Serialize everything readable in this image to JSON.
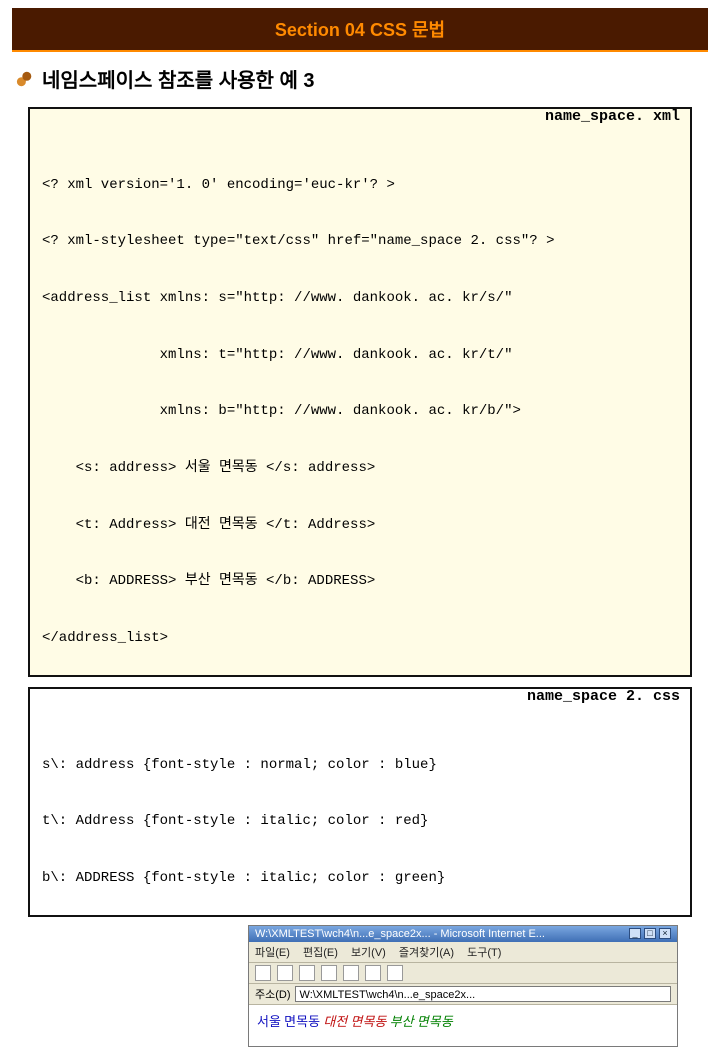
{
  "banner": {
    "title": "Section 04 CSS 문법"
  },
  "heading": {
    "text": "네임스페이스 참조를 사용한 예 3"
  },
  "xml_box": {
    "filename": "name_space. xml",
    "lines": [
      "<? xml version='1. 0' encoding='euc-kr'? >",
      "<? xml-stylesheet type=\"text/css\" href=\"name_space 2. css\"? >",
      "<address_list xmlns: s=\"http: //www. dankook. ac. kr/s/\"",
      "              xmlns: t=\"http: //www. dankook. ac. kr/t/\"",
      "              xmlns: b=\"http: //www. dankook. ac. kr/b/\">",
      "    <s: address> 서울 면목동 </s: address>",
      "    <t: Address> 대전 면목동 </t: Address>",
      "    <b: ADDRESS> 부산 면목동 </b: ADDRESS>",
      "</address_list>"
    ]
  },
  "css_box": {
    "filename": "name_space 2. css",
    "lines": [
      "s\\: address {font-style : normal; color : blue}",
      "t\\: Address {font-style : italic; color : red}",
      "b\\: ADDRESS {font-style : italic; color : green}"
    ]
  },
  "browser": {
    "title": "W:\\XMLTEST\\wch4\\n...e_space2x... - Microsoft Internet E...",
    "menu": [
      "파일(E)",
      "편집(E)",
      "보기(V)",
      "즐겨찾기(A)",
      "도구(T)"
    ],
    "address_label": "주소(D)",
    "address_value": "W:\\XMLTEST\\wch4\\n...e_space2x...",
    "rendered": {
      "l1": "서울 면목동",
      "l2": "대전 면목동",
      "l3": "부산 면목동"
    }
  }
}
